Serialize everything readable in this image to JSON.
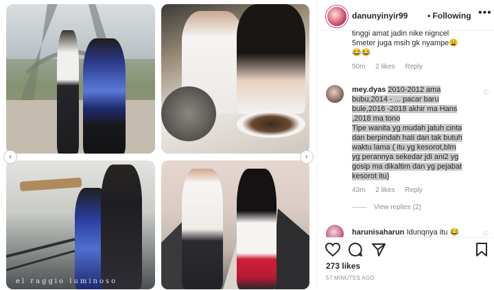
{
  "post": {
    "photo3_caption": "el raggio luminoso"
  },
  "header": {
    "username": "danunyinyir99",
    "follow_status": "• Following",
    "menu_glyph": "•••"
  },
  "comments": [
    {
      "text_lines": [
        "tinggi amat jadin nike nigncel",
        "5meter juga msih gk nyampe😩",
        "😂😂"
      ],
      "time": "50m",
      "likes": "2 likes",
      "reply": "Reply"
    },
    {
      "username": "mey.dyas",
      "text_lines": [
        "2010-2012 ama",
        "bubu,2014 - ... pacar baru",
        "bule,2016 -2018 akhir ma Hans",
        ",2018 ma tono",
        "Tipe wanita yg mudah jatuh cinta",
        "dan berpindah hati dan tak butuh",
        "waktu lama ( itu yg kesorot,blm",
        "yg perannya sekedar jdi ani2 yg",
        "gosip ma dikaltim dan yg pejabat",
        "kesorot itu)"
      ],
      "time": "43m",
      "likes": "2 likes",
      "reply": "Reply",
      "view_replies": "View replies (2)"
    },
    {
      "username": "harunisaharun",
      "text": "Idunqnya itu 😂"
    }
  ],
  "actions": {
    "likes": "273 likes",
    "timestamp": "57 MINUTES AGO"
  },
  "colors": {
    "text": "#262626",
    "secondary": "#8e8e8e",
    "border": "#efefef"
  }
}
